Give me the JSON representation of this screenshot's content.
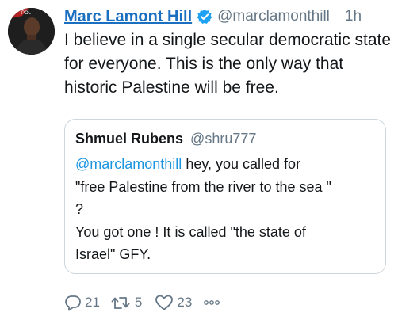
{
  "tweet": {
    "author_name": "Marc Lamont Hill",
    "handle": "@marclamonthill",
    "timestamp": "1h",
    "verified": true,
    "text": "I believe in a single secular democratic state for everyone. This is the only way that historic Palestine will be free.",
    "avatar_icon": "profile-photo"
  },
  "quoted_tweet": {
    "author_name": "Shmuel Rubens",
    "handle": "@shru777",
    "mention": "@marclamonthill",
    "lines": [
      " hey, you called for",
      "\"free Palestine from the river to the sea \"",
      "?",
      "You got one ! It is called \"the state of",
      "Israel\"  GFY."
    ]
  },
  "actions": {
    "reply_count": "21",
    "retweet_count": "5",
    "like_count": "23",
    "reply_icon": "reply-icon",
    "retweet_icon": "retweet-icon",
    "like_icon": "heart-icon",
    "more_icon": "more-options-icon"
  },
  "colors": {
    "name_link": "#1b6fc0",
    "mention": "#1b95e0",
    "verified": "#1da1f2",
    "secondary_text": "#657786",
    "border": "#ccd6dd"
  }
}
